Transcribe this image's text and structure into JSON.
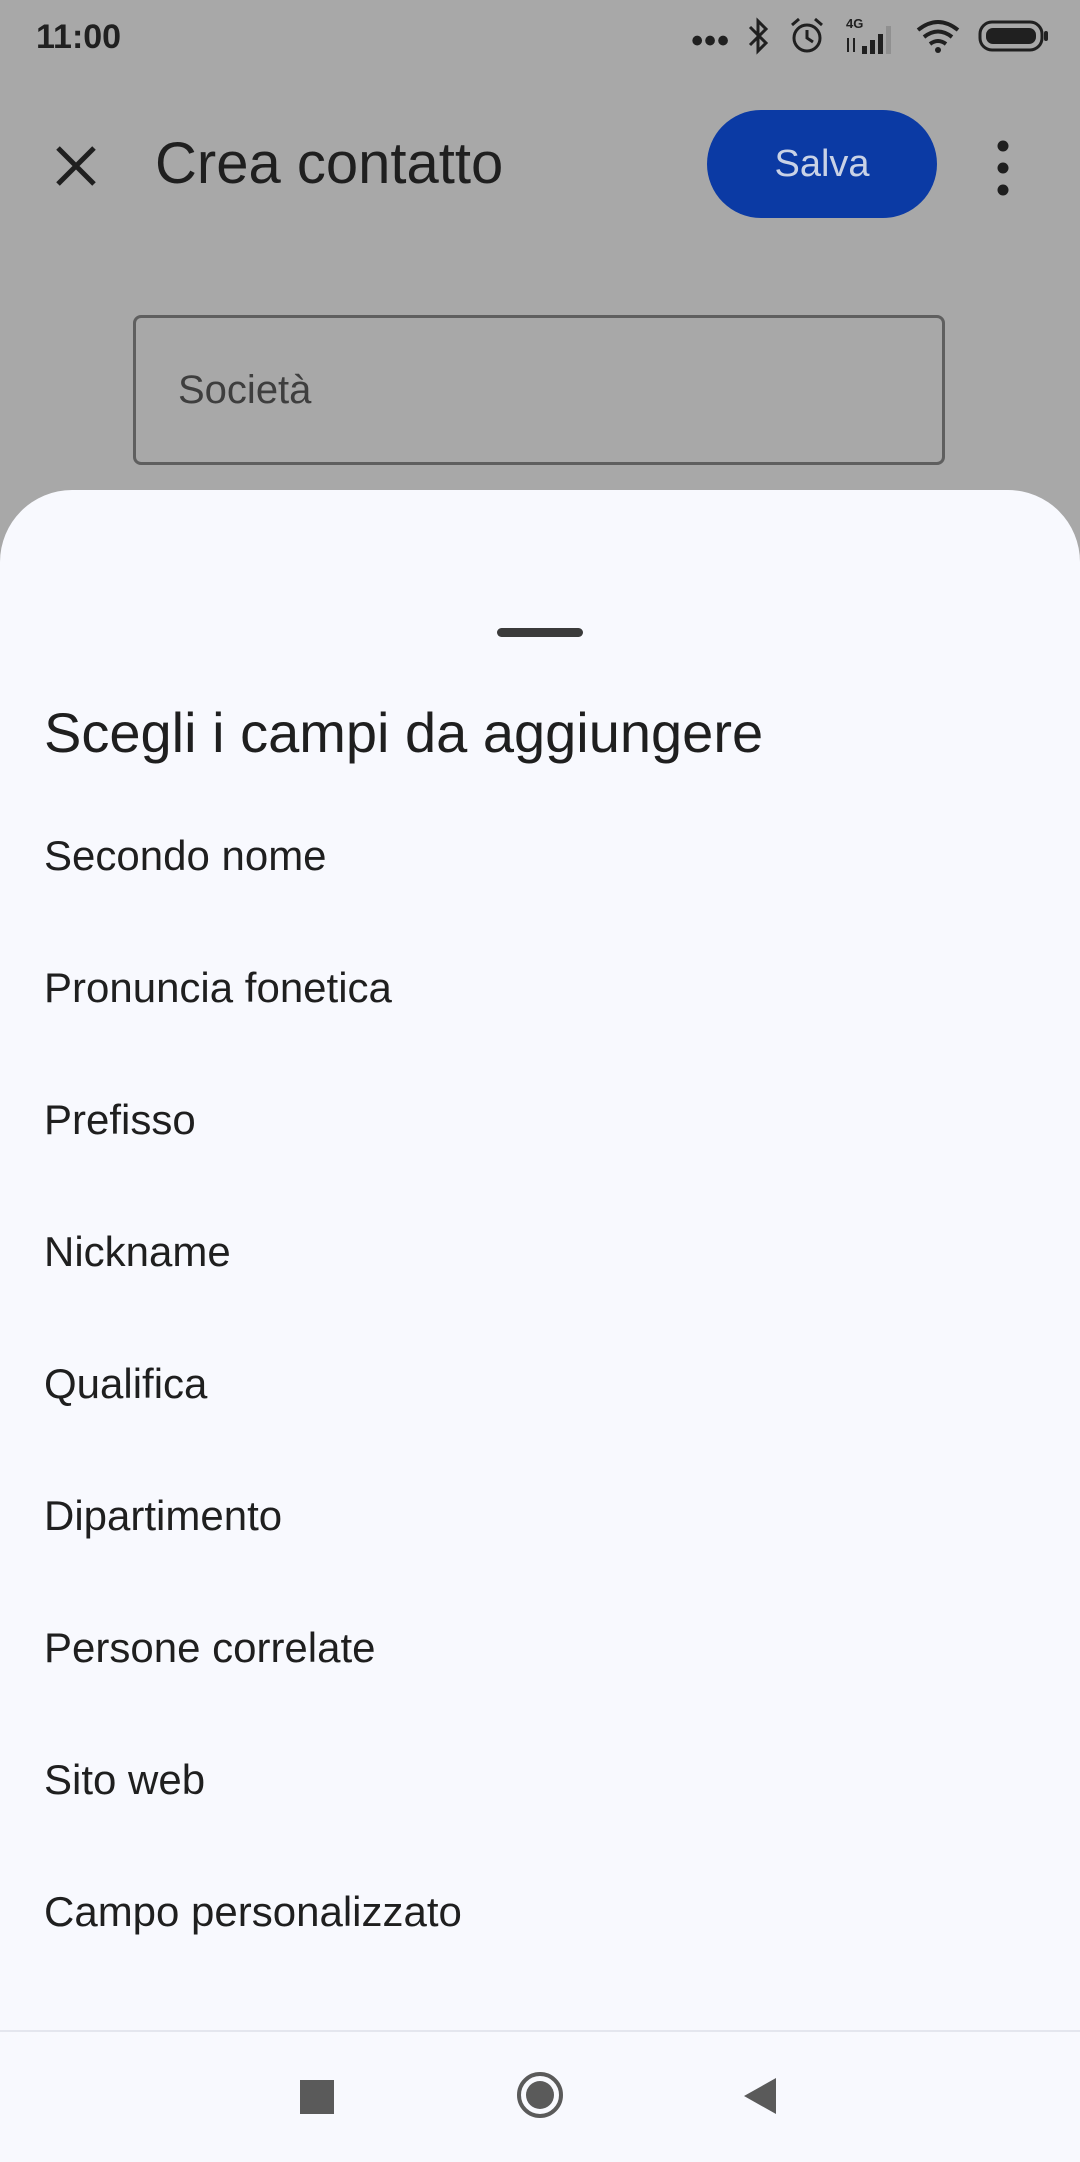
{
  "status_bar": {
    "time": "11:00",
    "dots": "•••",
    "network_label": "4G",
    "icons": [
      "bluetooth-icon",
      "alarm-icon",
      "signal-icon",
      "wifi-icon",
      "battery-icon"
    ]
  },
  "app_bar": {
    "title": "Crea contatto",
    "save_label": "Salva",
    "close_icon": "close-icon",
    "more_icon": "more-vert-icon"
  },
  "form": {
    "company_placeholder": "Società"
  },
  "sheet": {
    "title": "Scegli i campi da aggiungere",
    "fields": [
      "Secondo nome",
      "Pronuncia fonetica",
      "Prefisso",
      "Nickname",
      "Qualifica",
      "Dipartimento",
      "Persone correlate",
      "Sito web",
      "Campo personalizzato"
    ]
  },
  "colors": {
    "scrim": "#a8a8a8",
    "sheet_bg": "#f8f9fe",
    "accent": "#0b3aa4"
  }
}
